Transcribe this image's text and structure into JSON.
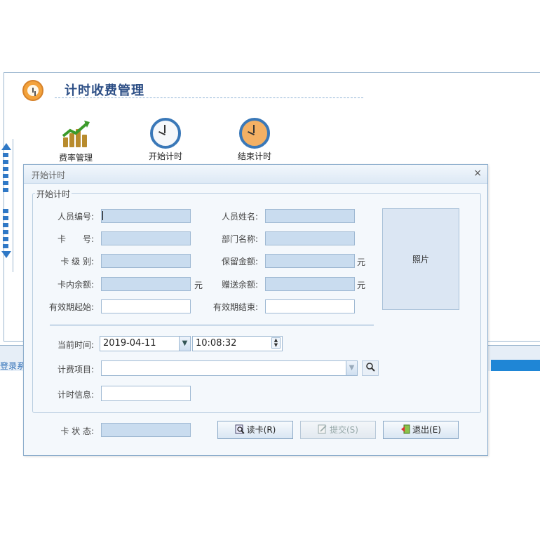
{
  "background": {
    "title": "计时收费管理",
    "tools": [
      {
        "label": "费率管理",
        "icon": "rate-chart-icon"
      },
      {
        "label": "开始计时",
        "icon": "clock-icon"
      },
      {
        "label": "结束计时",
        "icon": "clock-end-icon"
      }
    ],
    "status_text": "登录系"
  },
  "dialog": {
    "title": "开始计时",
    "close": "×",
    "group_label": "开始计时",
    "fields": {
      "person_no": {
        "label": "人员编号:",
        "value": ""
      },
      "person_name": {
        "label": "人员姓名:",
        "value": ""
      },
      "card_no": {
        "label": "卡　　号:",
        "value": ""
      },
      "dept_name": {
        "label": "部门名称:",
        "value": ""
      },
      "card_level": {
        "label": "卡 级 别:",
        "value": ""
      },
      "reserved_amount": {
        "label": "保留金额:",
        "value": "",
        "unit": "元"
      },
      "card_balance": {
        "label": "卡内余额:",
        "value": "",
        "unit": "元"
      },
      "gift_balance": {
        "label": "赠送余额:",
        "value": "",
        "unit": "元"
      },
      "valid_start": {
        "label": "有效期起始:",
        "value": ""
      },
      "valid_end": {
        "label": "有效期结束:",
        "value": ""
      },
      "current_time": {
        "label": "当前时间:",
        "date": "2019-04-11",
        "time": "10:08:32"
      },
      "billing_item": {
        "label": "计费项目:",
        "value": ""
      },
      "timing_info": {
        "label": "计时信息:",
        "value": ""
      },
      "card_status": {
        "label": "卡 状 态:",
        "value": ""
      }
    },
    "photo_label": "照片",
    "buttons": {
      "read_card": "读卡(R)",
      "submit": "提交(S)",
      "exit": "退出(E)"
    }
  }
}
